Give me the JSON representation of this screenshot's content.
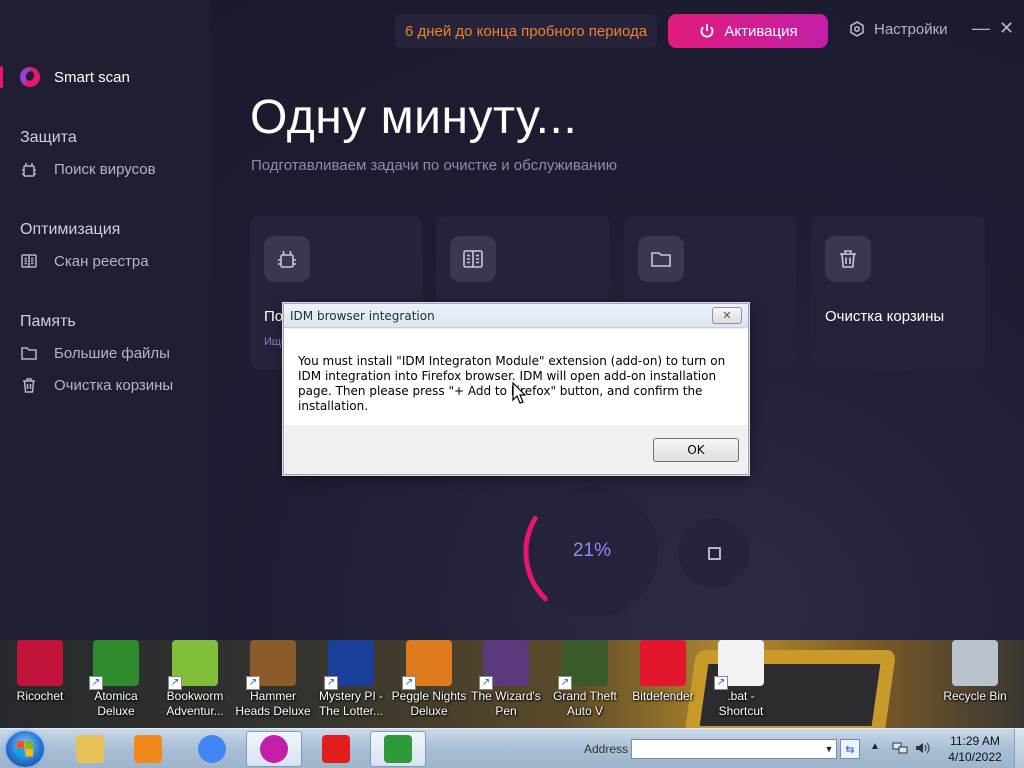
{
  "app": {
    "trial_text": "6 дней до конца пробного периода",
    "activate_label": "Активация",
    "settings_label": "Настройки",
    "minimize_glyph": "—",
    "close_glyph": "✕",
    "headline": "Одну минуту...",
    "subheadline": "Подготавливаем задачи по очистке и обслуживанию",
    "progress_label": "21%",
    "progress_percent": 21,
    "accent_color": "#e8176b",
    "trial_color": "#f0822e"
  },
  "sidebar": {
    "smart_scan": "Smart scan",
    "sections": [
      {
        "title": "Защита",
        "items": [
          {
            "label": "Поиск вирусов",
            "icon": "bug-icon"
          }
        ]
      },
      {
        "title": "Оптимизация",
        "items": [
          {
            "label": "Скан реестра",
            "icon": "registry-icon"
          }
        ]
      },
      {
        "title": "Память",
        "items": [
          {
            "label": "Большие файлы",
            "icon": "folder-icon"
          },
          {
            "label": "Очистка корзины",
            "icon": "trash-icon"
          }
        ]
      }
    ]
  },
  "cards": [
    {
      "title": "По",
      "sub": "Ище",
      "icon": "bug-icon"
    },
    {
      "title": "",
      "sub": "",
      "icon": "registry-icon"
    },
    {
      "title": "",
      "sub": "",
      "icon": "folder-icon"
    },
    {
      "title": "Очистка корзины",
      "sub": "",
      "icon": "trash-icon"
    }
  ],
  "dialog": {
    "title": "IDM browser integration",
    "close_glyph": "✕",
    "message": "You must install \"IDM Integraton Module\" extension (add-on) to turn on IDM integration into Firefox browser. IDM will open add-on installation page. Then please press \"+ Add to Firefox\" button, and confirm the installation.",
    "ok_label": "OK"
  },
  "desktop_icons": [
    {
      "label": "Ricochet",
      "color": "#c2143a",
      "shortcut": false
    },
    {
      "label": "Atomica\nDeluxe",
      "color": "#2e8b2e",
      "shortcut": true
    },
    {
      "label": "Bookworm\nAdventur...",
      "color": "#7fbf3a",
      "shortcut": true
    },
    {
      "label": "Hammer\nHeads Deluxe",
      "color": "#8a5a2a",
      "shortcut": true
    },
    {
      "label": "Mystery PI -\nThe Lotter...",
      "color": "#1a3f9a",
      "shortcut": true
    },
    {
      "label": "Peggle Nights\nDeluxe",
      "color": "#e07a1f",
      "shortcut": true
    },
    {
      "label": "The Wizard's\nPen",
      "color": "#5a3a7a",
      "shortcut": true
    },
    {
      "label": "Grand Theft\nAuto V",
      "color": "#3b5a2a",
      "shortcut": true
    },
    {
      "label": "Bitdefender",
      "color": "#e2172d",
      "shortcut": false
    },
    {
      "label": ".bat -\nShortcut",
      "color": "#f2f2f2",
      "shortcut": true
    },
    {
      "label": "Recycle Bin",
      "color": "#b9c3cc",
      "shortcut": false
    }
  ],
  "taskbar": {
    "apps": [
      {
        "name": "explorer-taskbar-button",
        "color": "#e8c05a"
      },
      {
        "name": "media-player-taskbar-button",
        "color": "#f08a1a"
      },
      {
        "name": "chrome-taskbar-button",
        "color": "#4285f4"
      },
      {
        "name": "antivirus-taskbar-button",
        "color": "#c21ea8"
      },
      {
        "name": "yandex-taskbar-button",
        "color": "#e31c1c"
      },
      {
        "name": "idm-taskbar-button",
        "color": "#2f9a3a"
      }
    ],
    "address_label": "Address",
    "address_value": "",
    "time": "11:29 AM",
    "date": "4/10/2022"
  }
}
